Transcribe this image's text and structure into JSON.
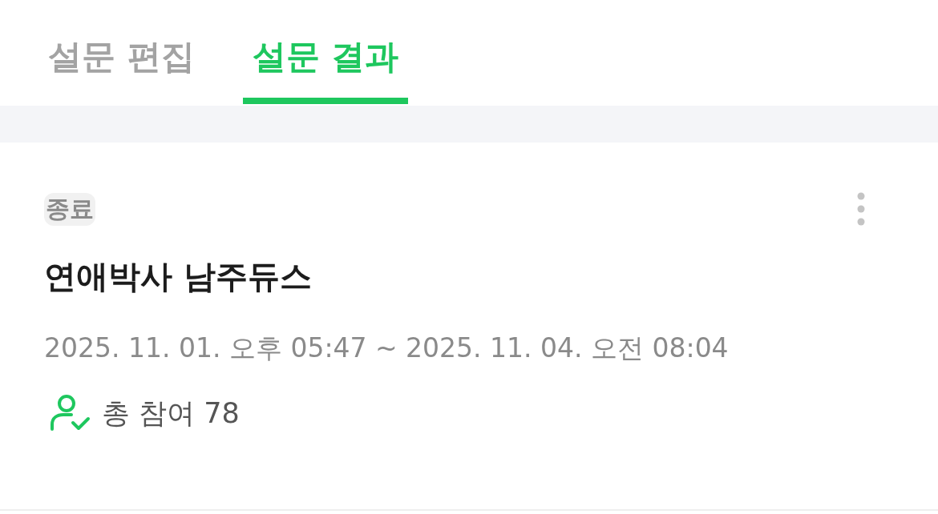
{
  "tabs": [
    {
      "label": "설문 편집",
      "selected": false
    },
    {
      "label": "설문 결과",
      "selected": true
    }
  ],
  "survey": {
    "status": "종료",
    "title": "연애박사 남주듀스",
    "period": "2025. 11. 01. 오후 05:47 ~ 2025. 11. 04. 오전 08:04",
    "participants": "총 참여 78"
  }
}
